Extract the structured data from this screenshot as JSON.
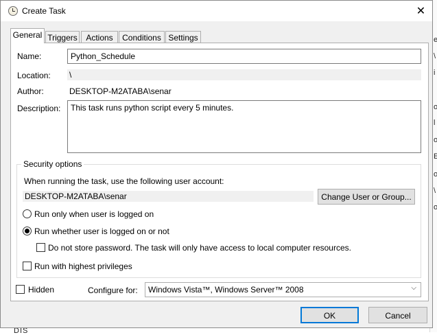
{
  "window": {
    "title": "Create Task",
    "close_glyph": "✕"
  },
  "tabs": [
    {
      "label": "General"
    },
    {
      "label": "Triggers"
    },
    {
      "label": "Actions"
    },
    {
      "label": "Conditions"
    },
    {
      "label": "Settings"
    }
  ],
  "general": {
    "name_label": "Name:",
    "name_value": "Python_Schedule",
    "location_label": "Location:",
    "location_value": "\\",
    "author_label": "Author:",
    "author_value": "DESKTOP-M2ATABA\\senar",
    "description_label": "Description:",
    "description_value": "This task runs python script every 5 minutes."
  },
  "security": {
    "legend": "Security options",
    "account_prompt": "When running the task, use the following user account:",
    "account_value": "DESKTOP-M2ATABA\\senar",
    "change_user_button": "Change User or Group...",
    "radio_logged_on": "Run only when user is logged on",
    "radio_logged_on_checked": false,
    "radio_whether": "Run whether user is logged on or not",
    "radio_whether_checked": true,
    "no_store_password": "Do not store password.  The task will only have access to local computer resources.",
    "highest_privileges": "Run with highest privileges"
  },
  "footer": {
    "hidden_label": "Hidden",
    "configure_label": "Configure for:",
    "configure_value": "Windows Vista™, Windows Server™ 2008",
    "ok_button": "OK",
    "cancel_button": "Cancel"
  },
  "background": {
    "right_fragments": [
      "e",
      "\\",
      "i",
      "o",
      "l",
      "o",
      "E",
      "o",
      "\\",
      "o"
    ],
    "bottom_fragment": "DIS"
  }
}
